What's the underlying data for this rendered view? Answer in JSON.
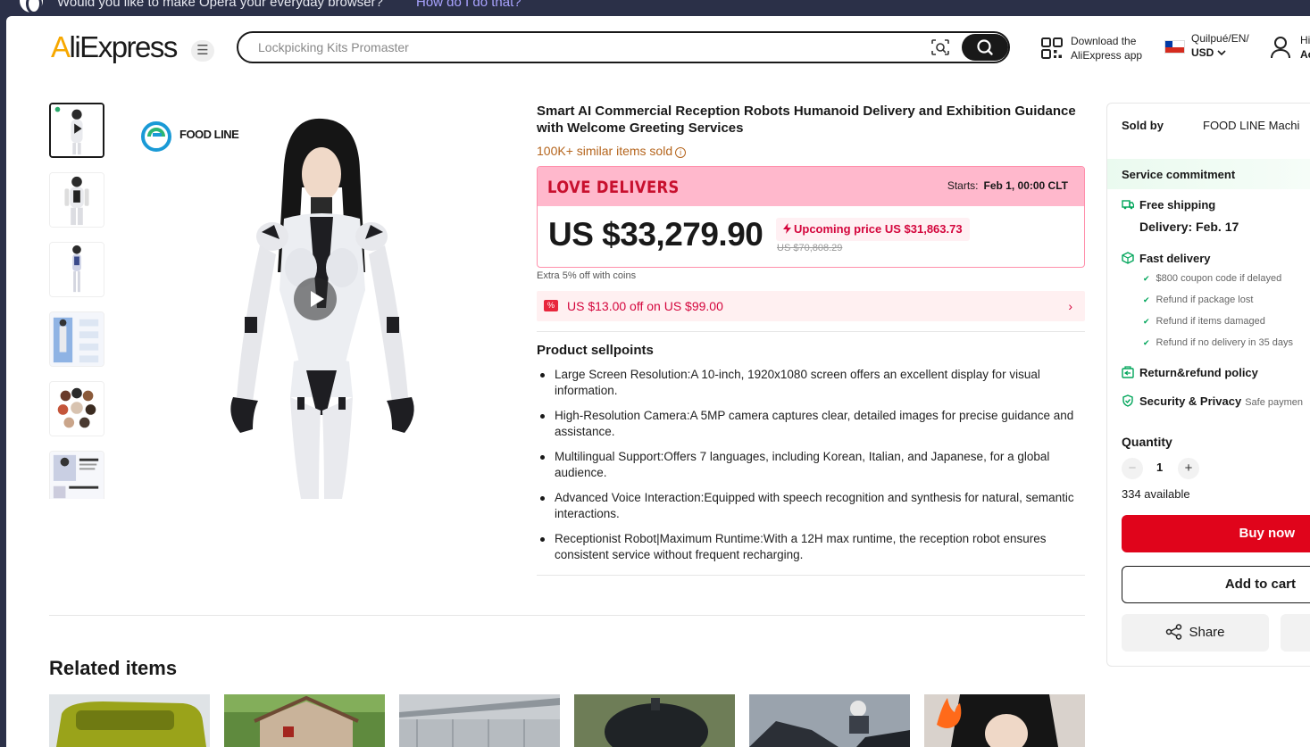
{
  "opera_bar": {
    "message": "Would you like to make Opera your everyday browser?",
    "link": "How do I do that?"
  },
  "header": {
    "brand_main": "AliExpress",
    "brand_accent": "A",
    "brand_rest": "liExpress",
    "menu_icon": "☰",
    "search_placeholder": "Lockpicking Kits Promaster",
    "download_line1": "Download the",
    "download_line2": "AliExpress app",
    "locale_line1": "Quilpué/EN/",
    "locale_line2": "USD",
    "account_line1": "Hi!",
    "account_line2": "Ac"
  },
  "gallery": {
    "logo_text": "FOOD LINE",
    "thumbnails": [
      "video-thumb",
      "robot-front",
      "robot-full",
      "robot-infographic",
      "robot-heads",
      "robot-features"
    ]
  },
  "product": {
    "title": "Smart AI Commercial Reception Robots Humanoid Delivery and Exhibition Guidance with Welcome Greeting Services",
    "sold": "100K+ similar items sold",
    "info_icon": "i",
    "promo_banner": "LOVE DELIVERS",
    "starts_label": "Starts:",
    "starts_value": "Feb 1, 00:00 CLT",
    "price": "US $33,279.90",
    "upcoming_price": "Upcoming price US $31,863.73",
    "original_price": "US $70,808.29",
    "coins_note": "Extra 5% off with coins",
    "coupon_text": "US $13.00 off on US $99.00",
    "coupon_arrow": "›",
    "sellpoints_title": "Product sellpoints",
    "sellpoints": [
      "Large Screen Resolution:A 10-inch, 1920x1080 screen offers an excellent display for visual information.",
      "High-Resolution Camera:A 5MP camera captures clear, detailed images for precise guidance and assistance.",
      "Multilingual Support:Offers 7 languages, including Korean, Italian, and Japanese, for a global audience.",
      "Advanced Voice Interaction:Equipped with speech recognition and synthesis for natural, semantic interactions.",
      "Receptionist Robot|Maximum Runtime:With a 12H max runtime, the reception robot ensures consistent service without frequent recharging."
    ]
  },
  "sidebar": {
    "sold_by_label": "Sold by",
    "store_name": "FOOD LINE Machi",
    "service_commitment": "Service commitment",
    "free_shipping": "Free shipping",
    "delivery": "Delivery: Feb. 17",
    "fast_delivery": "Fast delivery",
    "guarantees": [
      "$800 coupon code if delayed",
      "Refund if package lost",
      "Refund if items damaged",
      "Refund if no delivery in 35 days"
    ],
    "return_policy": "Return&refund policy",
    "security": "Security & Privacy",
    "security_sub": "Safe paymen",
    "quantity_label": "Quantity",
    "minus": "−",
    "plus": "+",
    "quantity": "1",
    "available": "334 available",
    "buy_now": "Buy now",
    "add_to_cart": "Add to cart",
    "share": "Share"
  },
  "related": {
    "title": "Related items"
  },
  "colors": {
    "brand_orange": "#f7a800",
    "buy_red": "#e0041b",
    "promo_pink": "#ffb8cc",
    "green": "#00a55a"
  }
}
